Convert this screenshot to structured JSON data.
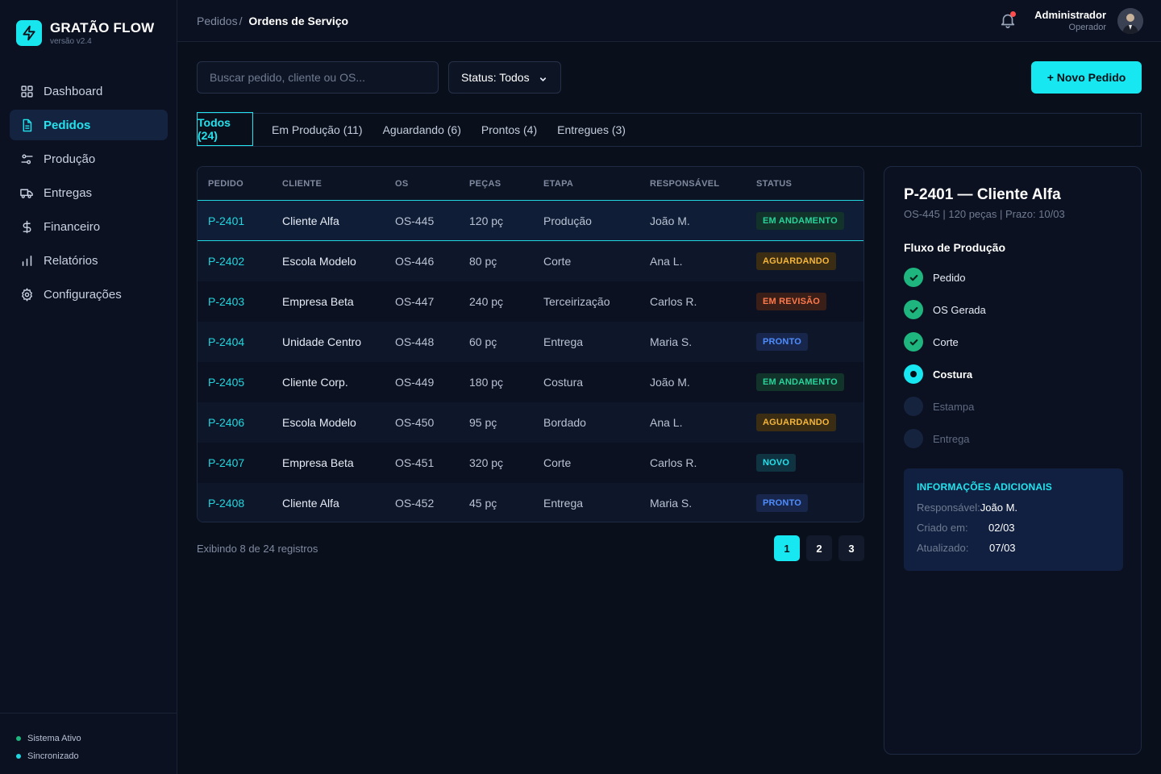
{
  "brand": {
    "name": "GRATÃO FLOW",
    "version": "versão v2.4",
    "accent": "#16e7f0"
  },
  "sidebar": {
    "items": [
      {
        "label": "Dashboard",
        "icon": "grid-icon"
      },
      {
        "label": "Pedidos",
        "icon": "document-icon",
        "active": true
      },
      {
        "label": "Produção",
        "icon": "sliders-icon"
      },
      {
        "label": "Entregas",
        "icon": "truck-icon"
      },
      {
        "label": "Financeiro",
        "icon": "dollar-icon"
      },
      {
        "label": "Relatórios",
        "icon": "bar-chart-icon"
      },
      {
        "label": "Configurações",
        "icon": "gear-icon"
      }
    ],
    "status": [
      {
        "label": "Sistema Ativo",
        "color": "#1fb57e"
      },
      {
        "label": "Sincronizado",
        "color": "#22d6df"
      }
    ]
  },
  "header": {
    "crumb_root": "Pedidos",
    "crumb_sep": "/",
    "crumb_current": "Ordens de Serviço",
    "user_name": "Administrador",
    "user_role": "Operador"
  },
  "toolbar": {
    "search_placeholder": "Buscar pedido, cliente ou OS...",
    "status_filter": "Status: Todos",
    "new_button": "+ Novo Pedido"
  },
  "tabs": [
    {
      "label": "Todos (24)",
      "active": true
    },
    {
      "label": "Em Produção (11)"
    },
    {
      "label": "Aguardando (6)"
    },
    {
      "label": "Prontos (4)"
    },
    {
      "label": "Entregues (3)"
    }
  ],
  "table": {
    "columns": [
      "PEDIDO",
      "CLIENTE",
      "OS",
      "PEÇAS",
      "ETAPA",
      "RESPONSÁVEL",
      "STATUS"
    ],
    "rows": [
      {
        "pedido": "P-2401",
        "cliente": "Cliente Alfa",
        "os": "OS-445",
        "pecas": "120 pç",
        "etapa": "Produção",
        "resp": "João M.",
        "status": "EM ANDAMENTO",
        "status_kind": "andamento",
        "selected": true
      },
      {
        "pedido": "P-2402",
        "cliente": "Escola Modelo",
        "os": "OS-446",
        "pecas": "80 pç",
        "etapa": "Corte",
        "resp": "Ana L.",
        "status": "AGUARDANDO",
        "status_kind": "aguardando"
      },
      {
        "pedido": "P-2403",
        "cliente": "Empresa Beta",
        "os": "OS-447",
        "pecas": "240 pç",
        "etapa": "Terceirização",
        "resp": "Carlos R.",
        "status": "EM REVISÃO",
        "status_kind": "revisao"
      },
      {
        "pedido": "P-2404",
        "cliente": "Unidade Centro",
        "os": "OS-448",
        "pecas": "60 pç",
        "etapa": "Entrega",
        "resp": "Maria S.",
        "status": "PRONTO",
        "status_kind": "pronto"
      },
      {
        "pedido": "P-2405",
        "cliente": "Cliente Corp.",
        "os": "OS-449",
        "pecas": "180 pç",
        "etapa": "Costura",
        "resp": "João M.",
        "status": "EM ANDAMENTO",
        "status_kind": "andamento"
      },
      {
        "pedido": "P-2406",
        "cliente": "Escola Modelo",
        "os": "OS-450",
        "pecas": "95 pç",
        "etapa": "Bordado",
        "resp": "Ana L.",
        "status": "AGUARDANDO",
        "status_kind": "aguardando"
      },
      {
        "pedido": "P-2407",
        "cliente": "Empresa Beta",
        "os": "OS-451",
        "pecas": "320 pç",
        "etapa": "Corte",
        "resp": "Carlos R.",
        "status": "NOVO",
        "status_kind": "novo"
      },
      {
        "pedido": "P-2408",
        "cliente": "Cliente Alfa",
        "os": "OS-452",
        "pecas": "45 pç",
        "etapa": "Entrega",
        "resp": "Maria S.",
        "status": "PRONTO",
        "status_kind": "pronto"
      }
    ]
  },
  "pagination": {
    "showing": "Exibindo 8 de 24 registros",
    "pages": [
      "1",
      "2",
      "3"
    ],
    "current": "1"
  },
  "details": {
    "title": "P-2401 — Cliente Alfa",
    "subtitle": "OS-445 | 120 peças | Prazo: 10/03",
    "flow_title": "Fluxo de Produção",
    "steps": [
      {
        "label": "Pedido",
        "state": "done"
      },
      {
        "label": "OS Gerada",
        "state": "done"
      },
      {
        "label": "Corte",
        "state": "done"
      },
      {
        "label": "Costura",
        "state": "current"
      },
      {
        "label": "Estampa",
        "state": "todo"
      },
      {
        "label": "Entrega",
        "state": "todo"
      }
    ],
    "info_title": "INFORMAÇÕES ADICIONAIS",
    "info": [
      {
        "k": "Responsável:",
        "v": "João M."
      },
      {
        "k": "Criado em:",
        "v": "02/03"
      },
      {
        "k": "Atualizado:",
        "v": "07/03"
      }
    ]
  }
}
